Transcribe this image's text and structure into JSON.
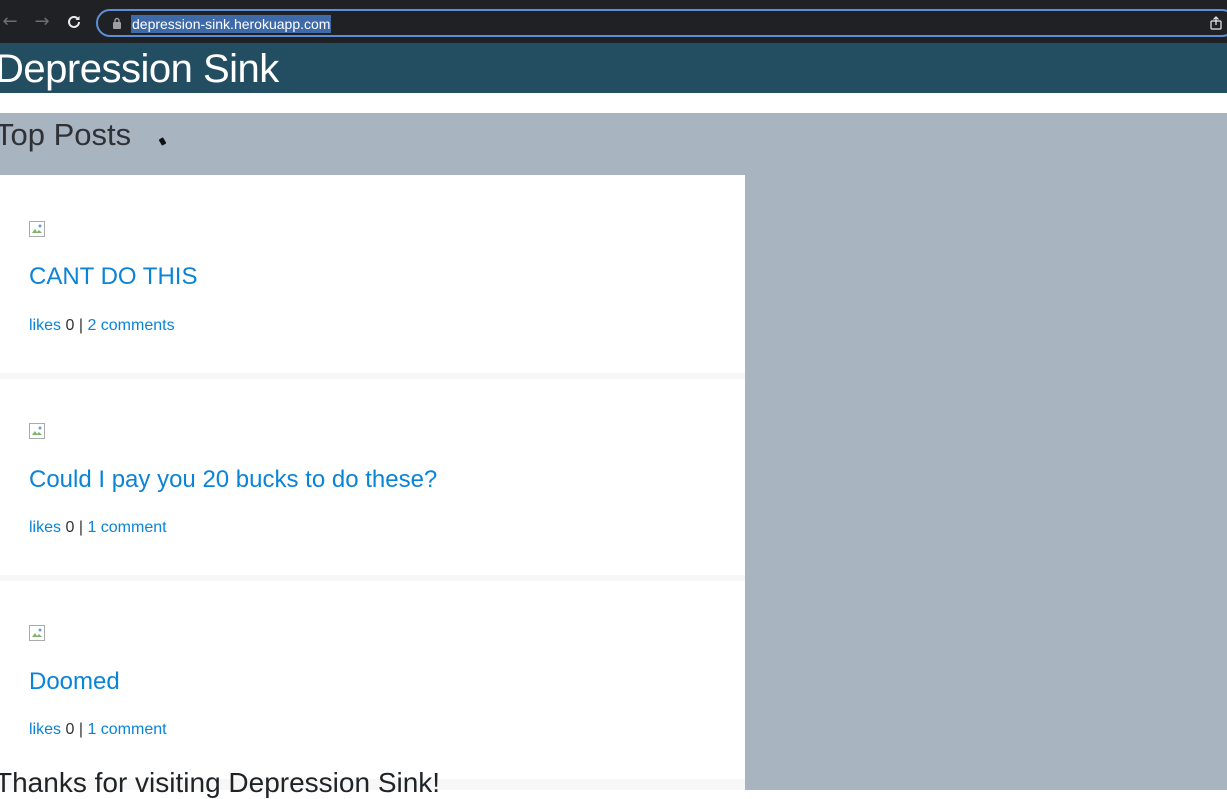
{
  "browser": {
    "url": "depression-sink.herokuapp.com",
    "back_icon": "arrow-left-icon",
    "forward_icon": "arrow-right-icon",
    "reload_icon": "reload-icon"
  },
  "header": {
    "title": "Depression Sink",
    "background": "#234e62"
  },
  "main": {
    "section_title": "Top Posts",
    "background": "#a9b4c1",
    "posts": [
      {
        "title": "CANT DO THIS",
        "likes_label": "likes",
        "likes_count": "0",
        "separator": "|",
        "comments": "2 comments"
      },
      {
        "title": "Could I pay you 20 bucks to do these?",
        "likes_label": "likes",
        "likes_count": "0",
        "separator": "|",
        "comments": "1 comment"
      },
      {
        "title": "Doomed",
        "likes_label": "likes",
        "likes_count": "0",
        "separator": "|",
        "comments": "1 comment"
      }
    ],
    "footer": "Thanks for visiting Depression Sink!"
  },
  "colors": {
    "link": "#0a84d8",
    "text": "#333333"
  }
}
